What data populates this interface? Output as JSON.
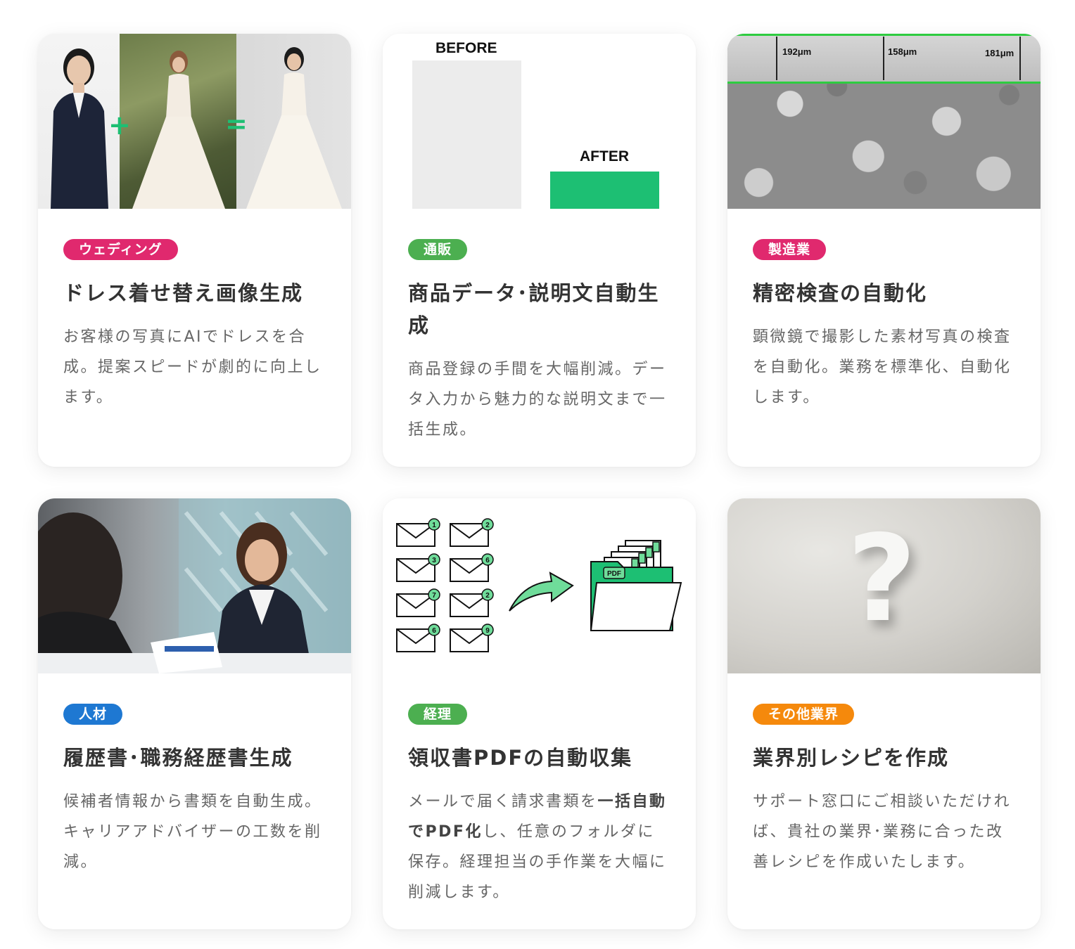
{
  "cards": [
    {
      "badge": "ウェディング",
      "badge_color": "#e0296e",
      "title": "ドレス着せ替え画像生成",
      "desc": "お客様の写真にAIでドレスを合成。提案スピードが劇的に向上します。",
      "media": {
        "plus": "+",
        "equals": "="
      }
    },
    {
      "badge": "通販",
      "badge_color": "#4caf50",
      "title": "商品データ･説明文自動生成",
      "desc": "商品登録の手間を大幅削減。データ入力から魅力的な説明文まで一括生成。",
      "media": {
        "before": "BEFORE",
        "after": "AFTER"
      }
    },
    {
      "badge": "製造業",
      "badge_color": "#e0296e",
      "title": "精密検査の自動化",
      "desc": "顕微鏡で撮影した素材写真の検査を自動化。業務を標準化、自動化します。",
      "media": {
        "measurements": [
          "192μm",
          "158μm",
          "181μm"
        ]
      }
    },
    {
      "badge": "人材",
      "badge_color": "#1e78d2",
      "title": "履歴書･職務経歴書生成",
      "desc": "候補者情報から書類を自動生成。キャリアアドバイザーの工数を削減。"
    },
    {
      "badge": "経理",
      "badge_color": "#4caf50",
      "title": "領収書PDFの自動収集",
      "desc_pre": "メールで届く請求書類を",
      "desc_bold": "一括自動でPDF化",
      "desc_post": "し、任意のフォルダに保存。経理担当の手作業を大幅に削減します。",
      "media": {
        "badges": [
          "1",
          "2",
          "3",
          "6",
          "7",
          "2",
          "6",
          "9"
        ],
        "pdf": "PDF"
      }
    },
    {
      "badge": "その他業界",
      "badge_color": "#f5890c",
      "title": "業界別レシピを作成",
      "desc": "サポート窓口にご相談いただければ、貴社の業界･業務に合った改善レシピを作成いたします。",
      "media": {
        "symbol": "?"
      }
    }
  ],
  "colors": {
    "accent_green": "#1dbf73",
    "title_text": "#333333",
    "desc_text": "#666666"
  }
}
